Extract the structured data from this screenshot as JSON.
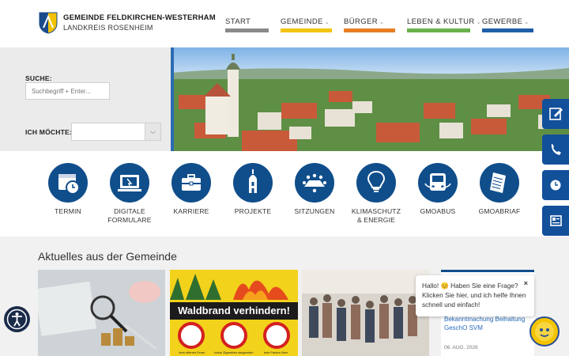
{
  "brand": {
    "title": "GEMEINDE FELDKIRCHEN-WESTERHAM",
    "subtitle": "LANDKREIS ROSENHEIM"
  },
  "nav": [
    {
      "label": "START",
      "chevron": "",
      "color": "#8a8a8a"
    },
    {
      "label": "GEMEINDE",
      "chevron": "⌄",
      "color": "#f1c40f"
    },
    {
      "label": "BÜRGER",
      "chevron": "⌄",
      "color": "#e67e22"
    },
    {
      "label": "LEBEN & KULTUR",
      "chevron": "⌄",
      "color": "#6ab04c"
    },
    {
      "label": "GEWERBE",
      "chevron": "⌄",
      "color": "#1f5fa6"
    }
  ],
  "search": {
    "label": "SUCHE:",
    "placeholder": "Suchbegriff + Enter..."
  },
  "want": {
    "label": "ICH MÖCHTE:",
    "value": ""
  },
  "tiles": [
    {
      "line1": "TERMIN",
      "line2": "",
      "icon": "calendar-clock-icon"
    },
    {
      "line1": "DIGITALE",
      "line2": "FORMULARE",
      "icon": "computer-form-icon"
    },
    {
      "line1": "KARRIERE",
      "line2": "",
      "icon": "briefcase-icon"
    },
    {
      "line1": "PROJEKTE",
      "line2": "",
      "icon": "church-tower-icon"
    },
    {
      "line1": "SITZUNGEN",
      "line2": "",
      "icon": "meeting-table-icon"
    },
    {
      "line1": "KLIMASCHUTZ",
      "line2": "& ENERGIE",
      "icon": "lightbulb-icon"
    },
    {
      "line1": "GMOABUS",
      "line2": "",
      "icon": "bus-icon"
    },
    {
      "line1": "GMOABRIAF",
      "line2": "",
      "icon": "newsletter-icon"
    }
  ],
  "news": {
    "title": "Aktuelles aus der Gemeinde",
    "card2_banner": "Waldbrand verhindern!",
    "card2_signs": [
      "kein offenes Feuer",
      "keine Zigaretten wegwerfen",
      "kein Parken über"
    ],
    "side_link": "Bekanntmachung Beihaltung GeschO SVM",
    "side_date": "06. AUG. 2026"
  },
  "chat": {
    "text": "Hallo! 😊 Haben Sie eine Frage? Klicken Sie hier, und ich helfe Ihnen schnell und einfach!",
    "close": "×"
  },
  "colors": {
    "primary": "#104e8b",
    "side_tabs": "#12509a"
  }
}
